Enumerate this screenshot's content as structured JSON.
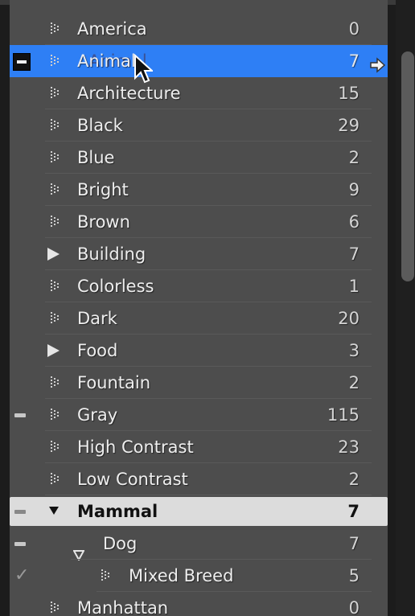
{
  "keyword_list": {
    "rows": [
      {
        "label": "America",
        "count": "0"
      },
      {
        "label": "Animal",
        "count": "7",
        "drag_ghost": "Animal"
      },
      {
        "label": "Architecture",
        "count": "15"
      },
      {
        "label": "Black",
        "count": "29"
      },
      {
        "label": "Blue",
        "count": "2"
      },
      {
        "label": "Bright",
        "count": "9"
      },
      {
        "label": "Brown",
        "count": "6"
      },
      {
        "label": "Building",
        "count": "7"
      },
      {
        "label": "Colorless",
        "count": "1"
      },
      {
        "label": "Dark",
        "count": "20"
      },
      {
        "label": "Food",
        "count": "3"
      },
      {
        "label": "Fountain",
        "count": "2"
      },
      {
        "label": "Gray",
        "count": "115"
      },
      {
        "label": "High Contrast",
        "count": "23"
      },
      {
        "label": "Low Contrast",
        "count": "2"
      },
      {
        "label": "Mammal",
        "count": "7"
      },
      {
        "label": "Dog",
        "count": "7"
      },
      {
        "label": "Mixed Breed",
        "count": "5"
      },
      {
        "label": "Manhattan",
        "count": "0"
      }
    ]
  },
  "colors": {
    "panel_bg": "#4d4d4d",
    "selected_row": "#2e7ff5",
    "highlighted_row": "#dcdcdc"
  },
  "icons": {
    "leaf": "keyword-dots-icon",
    "collapsed": "triangle-right-icon",
    "expanded": "triangle-down-icon",
    "partial": "minus-icon",
    "applied": "checkmark-icon",
    "filter": "arrow-right-icon"
  }
}
